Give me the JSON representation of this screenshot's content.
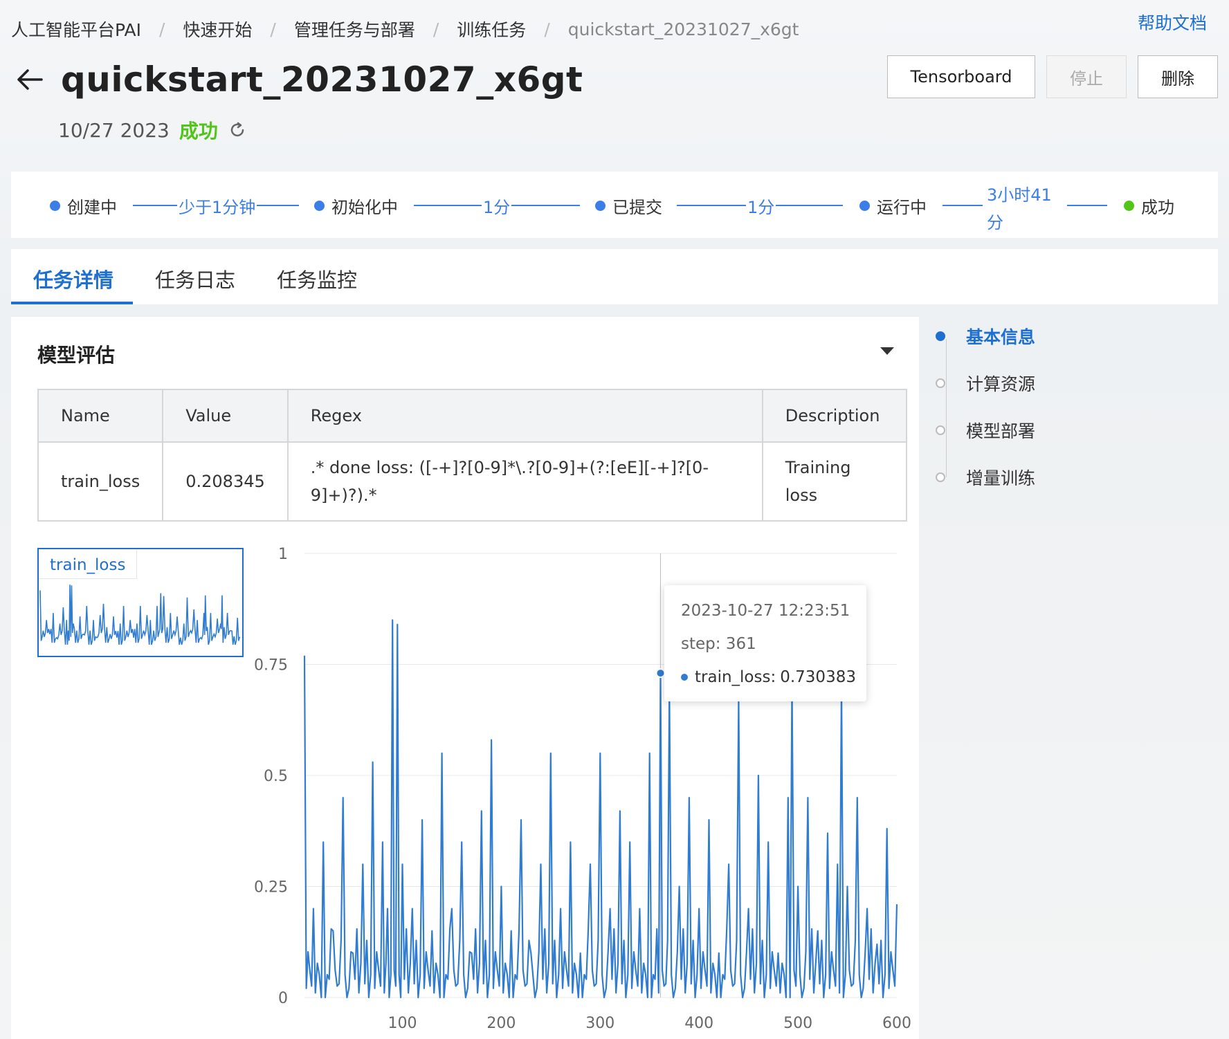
{
  "breadcrumb": [
    "人工智能平台PAI",
    "快速开始",
    "管理任务与部署",
    "训练任务",
    "quickstart_20231027_x6gt"
  ],
  "help_link": "帮助文档",
  "header": {
    "title": "quickstart_20231027_x6gt",
    "date": "10/27 2023",
    "status": "成功",
    "buttons": {
      "tensorboard": "Tensorboard",
      "stop": "停止",
      "delete": "删除"
    }
  },
  "stages": [
    {
      "label": "创建中",
      "status": "done"
    },
    {
      "label": "初始化中",
      "status": "done"
    },
    {
      "label": "已提交",
      "status": "done"
    },
    {
      "label": "运行中",
      "status": "done"
    },
    {
      "label": "成功",
      "status": "success"
    }
  ],
  "durations": [
    "少于1分钟",
    "1分",
    "1分",
    "3小时41\n分"
  ],
  "tabs": [
    "任务详情",
    "任务日志",
    "任务监控"
  ],
  "section": {
    "title": "模型评估"
  },
  "table": {
    "headers": [
      "Name",
      "Value",
      "Regex",
      "Description"
    ],
    "rows": [
      {
        "name": "train_loss",
        "value": "0.208345",
        "regex_line1": ".* done loss: ([-+]?[0-9]*\\.?[0-9]+(?:[eE][-+]?[0-",
        "regex_line2": "9]+)?).*",
        "desc_line1": "Training",
        "desc_line2": "loss"
      }
    ]
  },
  "thumbnail_label": "train_loss",
  "tooltip": {
    "time": "2023-10-27 12:23:51",
    "step": "step: 361",
    "series": "train_loss:",
    "value": "0.730383"
  },
  "anchor_nav": [
    {
      "label": "基本信息",
      "active": true
    },
    {
      "label": "计算资源",
      "active": false
    },
    {
      "label": "模型部署",
      "active": false
    },
    {
      "label": "增量训练",
      "active": false
    }
  ],
  "colors": {
    "accent": "#1e6fd0",
    "line": "#2f7cd0",
    "success": "#52c41a"
  },
  "chart_data": {
    "type": "line",
    "series": [
      {
        "name": "train_loss",
        "x": [
          1,
          10,
          20,
          30,
          40,
          50,
          60,
          70,
          80,
          85,
          90,
          95,
          100,
          110,
          120,
          130,
          140,
          150,
          160,
          170,
          180,
          190,
          200,
          210,
          220,
          230,
          240,
          250,
          260,
          270,
          280,
          290,
          300,
          310,
          320,
          330,
          340,
          350,
          361,
          370,
          380,
          390,
          400,
          410,
          420,
          430,
          440,
          450,
          460,
          470,
          480,
          490,
          494,
          500,
          510,
          520,
          530,
          540,
          544,
          550,
          560,
          570,
          580,
          590,
          600
        ],
        "y": [
          0.77,
          0.2,
          0.35,
          0.15,
          0.45,
          0.1,
          0.3,
          0.53,
          0.35,
          0.2,
          0.85,
          0.84,
          0.3,
          0.2,
          0.4,
          0.15,
          0.55,
          0.2,
          0.35,
          0.1,
          0.42,
          0.58,
          0.25,
          0.15,
          0.4,
          0.1,
          0.3,
          0.55,
          0.2,
          0.35,
          0.1,
          0.3,
          0.55,
          0.2,
          0.42,
          0.35,
          0.2,
          0.55,
          0.73,
          0.69,
          0.25,
          0.45,
          0.2,
          0.4,
          0.1,
          0.3,
          0.67,
          0.2,
          0.5,
          0.35,
          0.1,
          0.45,
          0.7,
          0.25,
          0.45,
          0.15,
          0.37,
          0.3,
          0.7,
          0.25,
          0.45,
          0.2,
          0.12,
          0.38,
          0.21
        ]
      }
    ],
    "xticks": [
      100,
      200,
      300,
      400,
      500,
      600
    ],
    "yticks": [
      0,
      0.25,
      0.5,
      0.75,
      1
    ],
    "xlim": [
      1,
      600
    ],
    "ylim": [
      0,
      1
    ],
    "grid": true,
    "highlight": {
      "x": 361,
      "y": 0.730383
    }
  }
}
